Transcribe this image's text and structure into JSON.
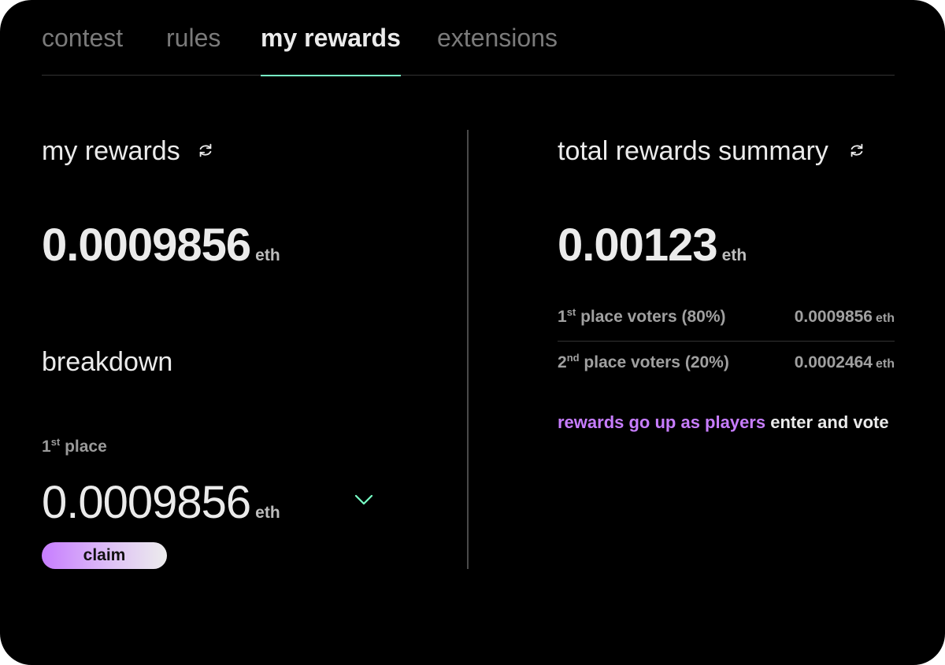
{
  "tabs": [
    {
      "label": "contest",
      "active": false
    },
    {
      "label": "rules",
      "active": false
    },
    {
      "label": "my rewards",
      "active": true
    },
    {
      "label": "extensions",
      "active": false
    }
  ],
  "my_rewards": {
    "title": "my rewards",
    "amount": "0.0009856",
    "unit": "eth",
    "breakdown_title": "breakdown",
    "place_num": "1",
    "place_sup": "st",
    "place_word": "place",
    "place_amount": "0.0009856",
    "place_unit": "eth",
    "claim_label": "claim"
  },
  "summary": {
    "title": "total rewards summary",
    "amount": "0.00123",
    "unit": "eth",
    "rows": [
      {
        "num": "1",
        "sup": "st",
        "text": "place voters (80%)",
        "value": "0.0009856",
        "unit": "eth"
      },
      {
        "num": "2",
        "sup": "nd",
        "text": "place voters (20%)",
        "value": "0.0002464",
        "unit": "eth"
      }
    ],
    "note_purple": "rewards go up as players",
    "note_white": "enter and vote"
  },
  "icons": {
    "refresh": "refresh-icon",
    "chevron": "chevron-down-icon"
  },
  "colors": {
    "accent_green": "#78ffc6",
    "accent_purple": "#c77dff",
    "background": "#000000"
  }
}
